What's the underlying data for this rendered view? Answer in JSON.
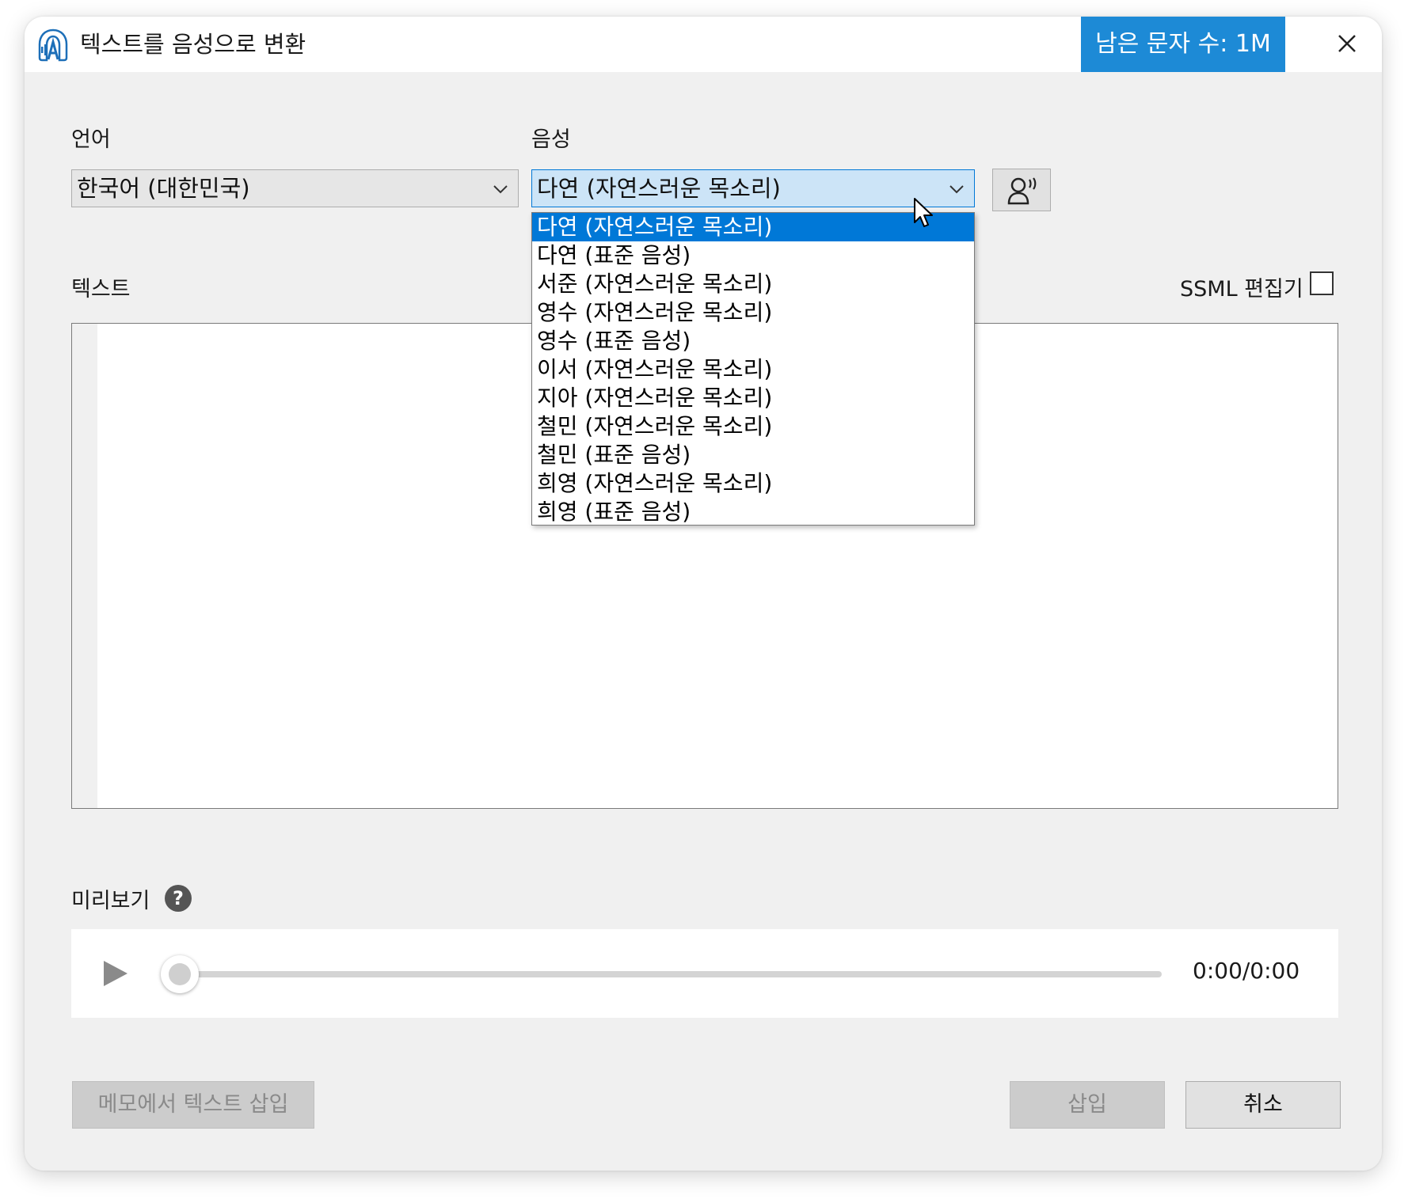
{
  "window": {
    "title": "텍스트를 음성으로 변환",
    "quota": "남은 문자 수: 1M"
  },
  "language": {
    "label": "언어",
    "selected": "한국어 (대한민국)"
  },
  "voice": {
    "label": "음성",
    "selected": "다연 (자연스러운 목소리)",
    "options": [
      "다연 (자연스러운 목소리)",
      "다연 (표준 음성)",
      "서준 (자연스러운 목소리)",
      "영수 (자연스러운 목소리)",
      "영수 (표준 음성)",
      "이서 (자연스러운 목소리)",
      "지아 (자연스러운 목소리)",
      "철민 (자연스러운 목소리)",
      "철민 (표준 음성)",
      "희영 (자연스러운 목소리)",
      "희영 (표준 음성)"
    ],
    "highlighted_index": 0
  },
  "text": {
    "label": "텍스트",
    "ssml_label": "SSML 편집기",
    "ssml_checked": false,
    "value": ""
  },
  "preview": {
    "label": "미리보기",
    "help": "?",
    "time": "0:00/0:00",
    "progress": 0
  },
  "footer": {
    "insert_from_memo": "메모에서 텍스트 삽입",
    "insert": "삽입",
    "cancel": "취소"
  },
  "colors": {
    "accent": "#1d8ad6",
    "selection": "#0078d7",
    "background": "#f0f0f0"
  },
  "icons": {
    "app": "text-to-speech-icon",
    "close": "close-icon",
    "voice_preview": "speaking-person-icon",
    "play": "play-icon",
    "help": "help-icon",
    "chevron": "chevron-down-icon"
  }
}
